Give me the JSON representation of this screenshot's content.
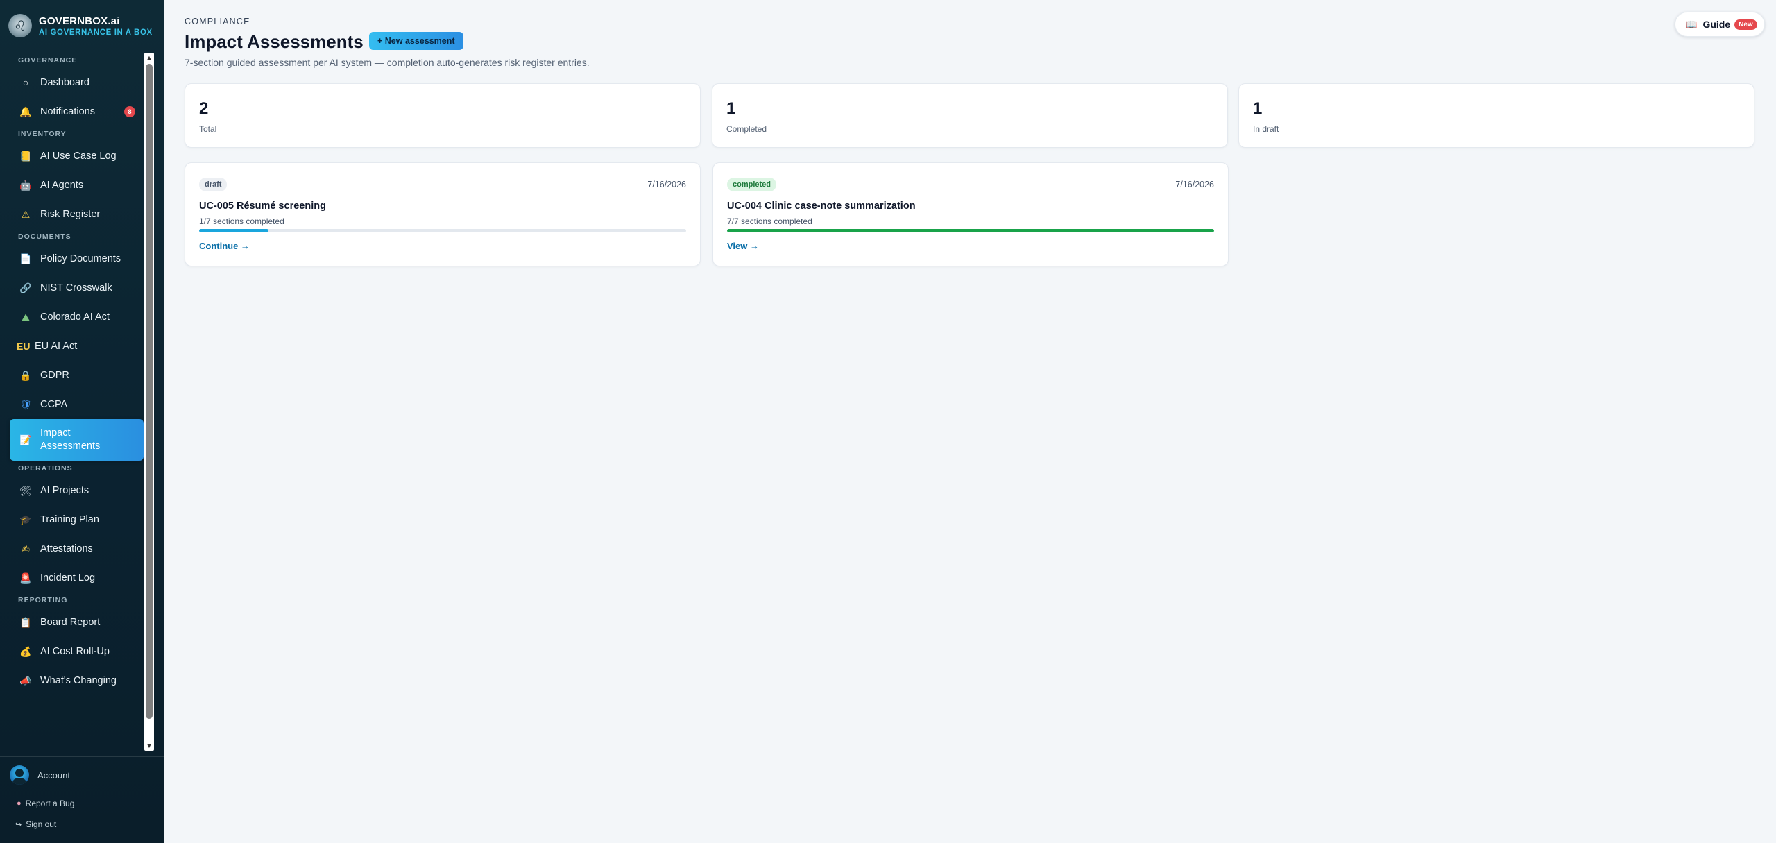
{
  "brand": {
    "name": "GOVERNBOX.ai",
    "tagline": "AI GOVERNANCE IN A BOX"
  },
  "sidebar": {
    "sections": [
      {
        "label": "GOVERNANCE",
        "items": [
          {
            "label": "Dashboard",
            "icon": "circle-icon"
          },
          {
            "label": "Notifications",
            "icon": "bell-icon",
            "badge": "8"
          }
        ]
      },
      {
        "label": "INVENTORY",
        "items": [
          {
            "label": "AI Use Case Log",
            "icon": "folder-icon"
          },
          {
            "label": "AI Agents",
            "icon": "robot-icon"
          },
          {
            "label": "Risk Register",
            "icon": "warning-icon"
          }
        ]
      },
      {
        "label": "DOCUMENTS",
        "items": [
          {
            "label": "Policy Documents",
            "icon": "document-icon"
          },
          {
            "label": "NIST Crosswalk",
            "icon": "link-icon"
          },
          {
            "label": "Colorado AI Act",
            "icon": "mountain-icon"
          },
          {
            "label": "EU AI Act",
            "icon": "eu-icon",
            "icon_text": "EU"
          },
          {
            "label": "GDPR",
            "icon": "lock-icon"
          },
          {
            "label": "CCPA",
            "icon": "shield-icon"
          },
          {
            "label": "Impact Assessments",
            "icon": "clipboard-icon",
            "active": true
          }
        ]
      },
      {
        "label": "OPERATIONS",
        "items": [
          {
            "label": "AI Projects",
            "icon": "tools-icon"
          },
          {
            "label": "Training Plan",
            "icon": "graduation-cap-icon"
          },
          {
            "label": "Attestations",
            "icon": "writing-hand-icon"
          },
          {
            "label": "Incident Log",
            "icon": "siren-icon"
          }
        ]
      },
      {
        "label": "REPORTING",
        "items": [
          {
            "label": "Board Report",
            "icon": "report-icon"
          },
          {
            "label": "AI Cost Roll-Up",
            "icon": "money-bag-icon"
          },
          {
            "label": "What's Changing",
            "icon": "megaphone-icon"
          }
        ]
      }
    ],
    "footer": {
      "account_label": "Account",
      "report_bug_label": "Report a Bug",
      "sign_out_label": "Sign out"
    }
  },
  "header": {
    "eyebrow": "COMPLIANCE",
    "title": "Impact Assessments",
    "new_button_label": "+ New assessment",
    "subtitle": "7-section guided assessment per AI system — completion auto-generates risk register entries.",
    "guide_label": "Guide",
    "guide_badge": "New"
  },
  "stats": [
    {
      "value": "2",
      "label": "Total"
    },
    {
      "value": "1",
      "label": "Completed"
    },
    {
      "value": "1",
      "label": "In draft"
    }
  ],
  "assessments": [
    {
      "status": "draft",
      "date": "7/16/2026",
      "title": "UC-005 Résumé screening",
      "progress_text": "1/7 sections completed",
      "progress": 0.142857,
      "action_label": "Continue →"
    },
    {
      "status": "completed",
      "date": "7/16/2026",
      "title": "UC-004 Clinic case-note summarization",
      "progress_text": "7/7 sections completed",
      "progress": 1.0,
      "action_label": "View →"
    }
  ],
  "colors": {
    "accent": "#2ab6e6",
    "sidebar_bg": "#0e2a36",
    "draft_bar": "#1aa6dd",
    "completed_bar": "#19a34a",
    "badge_red": "#e5484d"
  }
}
